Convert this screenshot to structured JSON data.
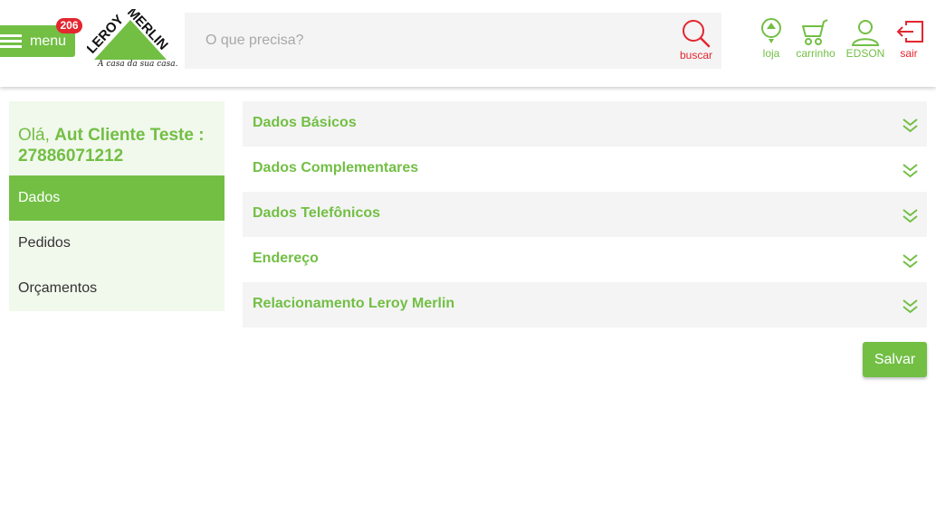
{
  "header": {
    "menu_label": "menu",
    "menu_badge": "206",
    "logo_text_1": "LEROY",
    "logo_text_2": "MERLIN",
    "logo_tagline": "A casa da sua casa.",
    "search_placeholder": "O que precisa?",
    "search_value": "",
    "search_label": "buscar",
    "store_label": "loja",
    "cart_label": "carrinho",
    "user_label": "EDSON",
    "logout_label": "sair",
    "colors": {
      "brand_green": "#72bf44",
      "accent_red": "#e3262f"
    }
  },
  "sidebar": {
    "greeting_prefix": "Olá,",
    "greeting_name": "Aut  Cliente Teste  :  27886071212",
    "items": [
      {
        "label": "Dados",
        "active": true
      },
      {
        "label": "Pedidos",
        "active": false
      },
      {
        "label": "Orçamentos",
        "active": false
      }
    ]
  },
  "main": {
    "sections": [
      {
        "title": "Dados Básicos",
        "icon": "double-chevron-down-icon"
      },
      {
        "title": "Dados Complementares",
        "icon": "double-chevron-down-icon"
      },
      {
        "title": "Dados Telefônicos",
        "icon": "double-chevron-down-icon"
      },
      {
        "title": "Endereço",
        "icon": "double-chevron-down-icon"
      },
      {
        "title": "Relacionamento Leroy Merlin",
        "icon": "double-chevron-down-icon"
      }
    ],
    "save_label": "Salvar"
  }
}
